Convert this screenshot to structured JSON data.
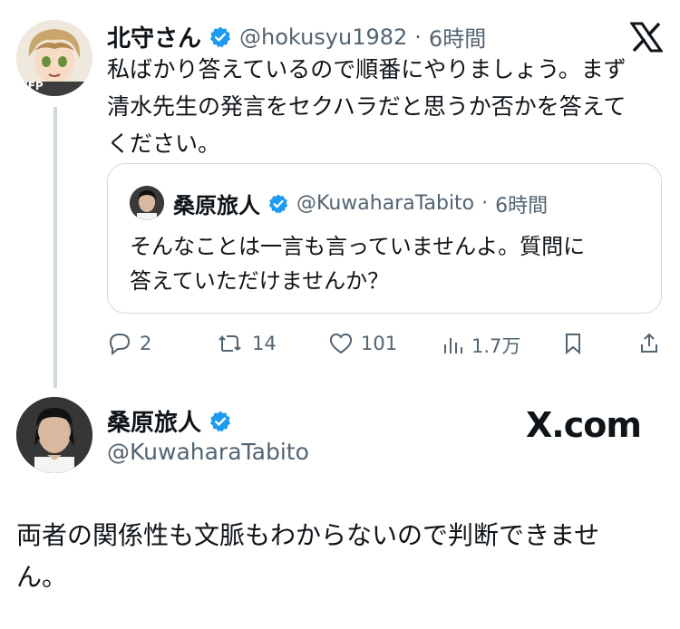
{
  "reply_tweet": {
    "name": "北守さん",
    "handle": "@hokusyu1982",
    "separator": "·",
    "time": "6時間",
    "lines": [
      "私ばかり答えているので順番にやりましょう。まず",
      "清水先生の発言をセクハラだと思うか否かを答えて",
      "ください。"
    ],
    "verified": true,
    "avatar_badge": "YFP"
  },
  "quoted_tweet": {
    "name": "桑原旅人",
    "handle": "@KuwaharaTabito",
    "separator": "·",
    "time": "6時間",
    "lines": [
      "そんなことは一言も言っていませんよ。質問に",
      "答えていただけませんか？"
    ],
    "verified": true
  },
  "actions": {
    "replies": "2",
    "retweets": "14",
    "likes": "101",
    "views": "1.7万"
  },
  "main_tweet": {
    "name": "桑原旅人",
    "handle": "@KuwaharaTabito",
    "lines": [
      "両者の関係性も文脈もわからないので判断できませ",
      "ん。"
    ],
    "verified": true
  },
  "branding": {
    "x_com": "X.com"
  },
  "colors": {
    "verified_blue": "#1d9bf0",
    "secondary_text": "#536471",
    "border": "#cfd9de"
  }
}
